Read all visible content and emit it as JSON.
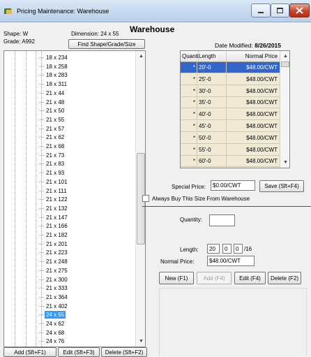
{
  "window": {
    "title": "Pricing Maintenance: Warehouse"
  },
  "heading": "Warehouse",
  "info": {
    "shape": "Shape: W",
    "grade": "Grade: A992",
    "dimension": "Dimension: 24 x 55",
    "date_label": "Date Modified:",
    "date_value": "8/26/2015"
  },
  "find_button": "Find Shape/Grade/Size",
  "tree": {
    "items": [
      "18 x 234",
      "18 x 258",
      "18 x 283",
      "18 x 311",
      "21 x 44",
      "21 x 48",
      "21 x 50",
      "21 x 55",
      "21 x 57",
      "21 x 62",
      "21 x 68",
      "21 x 73",
      "21 x 83",
      "21 x 93",
      "21 x 101",
      "21 x 111",
      "21 x 122",
      "21 x 132",
      "21 x 147",
      "21 x 166",
      "21 x 182",
      "21 x 201",
      "21 x 223",
      "21 x 248",
      "21 x 275",
      "21 x 300",
      "21 x 333",
      "21 x 364",
      "21 x 402",
      "24 x 55",
      "24 x 62",
      "24 x 68",
      "24 x 76"
    ],
    "selected": "24 x 55"
  },
  "tree_buttons": {
    "add": "Add (Sft+F1)",
    "edit": "Edit (Sft+F3)",
    "delete": "Delete (Sft+F2)"
  },
  "grid": {
    "headers": {
      "quantity": "Quantity",
      "length": "Length",
      "price": "Normal Price"
    },
    "rows": [
      {
        "quantity": "*",
        "length": "20'-0",
        "price": "$48.00/CWT"
      },
      {
        "quantity": "*",
        "length": "25'-0",
        "price": "$48.00/CWT"
      },
      {
        "quantity": "*",
        "length": "30'-0",
        "price": "$48.00/CWT"
      },
      {
        "quantity": "*",
        "length": "35'-0",
        "price": "$48.00/CWT"
      },
      {
        "quantity": "*",
        "length": "40'-0",
        "price": "$48.00/CWT"
      },
      {
        "quantity": "*",
        "length": "45'-0",
        "price": "$48.00/CWT"
      },
      {
        "quantity": "*",
        "length": "50'-0",
        "price": "$48.00/CWT"
      },
      {
        "quantity": "*",
        "length": "55'-0",
        "price": "$48.00/CWT"
      },
      {
        "quantity": "*",
        "length": "60'-0",
        "price": "$48.00/CWT"
      }
    ]
  },
  "form": {
    "special_label": "Special Price:",
    "special_value": "$0.00/CWT",
    "save": "Save (Sft+F4)",
    "always_label": "Always Buy This Size From Warehouse",
    "qty_label": "Quantity:",
    "qty_value": "",
    "length_label": "Length:",
    "len_ft": "20",
    "len_in": "0",
    "len_frac": "0",
    "len_unit": "/16",
    "normal_label": "Normal Price:",
    "normal_value": "$48.00/CWT",
    "new": "New (F1)",
    "add": "Add (F4)",
    "edit": "Edit (F4)",
    "delete": "Delete (F2)"
  },
  "colors": {
    "selection": "#3399ff",
    "grid_selection": "#3366cc",
    "grid_bg": "#f0e9d6"
  }
}
